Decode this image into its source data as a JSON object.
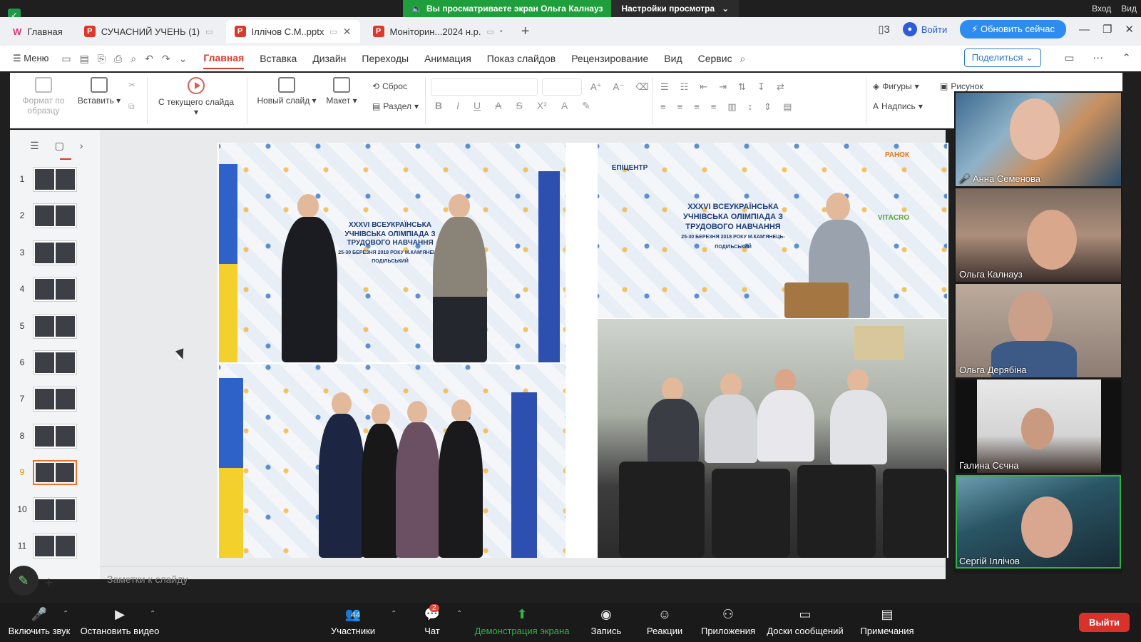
{
  "zoom_banner": {
    "sharing_text": "Вы просматриваете экран Ольга Калнауз",
    "view_settings": "Настройки просмотра",
    "right_items": [
      "Вход",
      "Вид"
    ]
  },
  "tabs": [
    {
      "label": "Главная",
      "type": "home"
    },
    {
      "label": "СУЧАСНИЙ УЧЕНЬ (1)",
      "type": "ppt"
    },
    {
      "label": "Іллічов С.М..pptx",
      "type": "ppt",
      "active": true
    },
    {
      "label": "Моніторин...2024 н.р.",
      "type": "ppt"
    }
  ],
  "tab_right": {
    "login": "Войти",
    "upgrade": "Обновить сейчас"
  },
  "menu": {
    "menu_label": "Меню",
    "ribbon_tabs": [
      "Главная",
      "Вставка",
      "Дизайн",
      "Переходы",
      "Анимация",
      "Показ слайдов",
      "Рецензирование",
      "Вид",
      "Сервис"
    ],
    "share": "Поделиться"
  },
  "ribbon": {
    "format_painter": "Формат по образцу",
    "paste": "Вставить",
    "from_current": "С текущего слайда",
    "new_slide": "Новый слайд",
    "layout": "Макет",
    "reset": "Сброс",
    "section": "Раздел",
    "shapes": "Фигуры",
    "picture": "Рисунок",
    "textbox": "Надпись"
  },
  "thumbnails": {
    "numbers": [
      "1",
      "2",
      "3",
      "4",
      "5",
      "6",
      "7",
      "8",
      "9",
      "10",
      "11"
    ],
    "selected": 9
  },
  "slide": {
    "banner_text": "XXXVI ВСЕУКРАЇНСЬКА УЧНІВСЬКА ОЛІМПІАДА З ТРУДОВОГО НАВЧАННЯ",
    "banner_sub": "25-30 БЕРЕЗНЯ 2018 РОКУ М.КАМ'ЯНЕЦЬ-ПОДІЛЬСЬКИЙ",
    "sponsor_ranok": "РАНОК",
    "sponsor_epicentr": "ЕПІЦЕНТР",
    "sponsor_vitacro": "VITACRO"
  },
  "notes_placeholder": "Заметки к слайду",
  "participants": [
    {
      "name": "Анна Семенова",
      "muted": true
    },
    {
      "name": "Ольга Калнауз"
    },
    {
      "name": "Ольга Дерябіна"
    },
    {
      "name": "Галина Сєчна"
    },
    {
      "name": "Сергій Іллічов",
      "active": true
    }
  ],
  "toolbar": {
    "unmute": "Включить звук",
    "stop_video": "Остановить видео",
    "participants": "Участники",
    "participants_count": "44",
    "chat": "Чат",
    "chat_badge": "2",
    "share_screen": "Демонстрация экрана",
    "record": "Запись",
    "reactions": "Реакции",
    "apps": "Приложения",
    "whiteboards": "Доски сообщений",
    "notes": "Примечания",
    "leave": "Выйти"
  },
  "colors": {
    "accent_red": "#d93a2c",
    "zoom_green": "#1f9e3c",
    "upgrade_blue": "#2e8cf0",
    "leave_red": "#d8322a"
  }
}
